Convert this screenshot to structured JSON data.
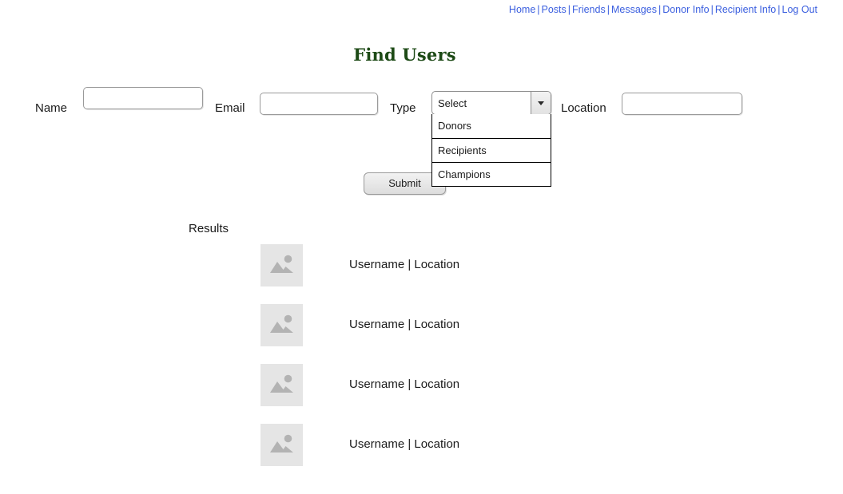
{
  "nav": {
    "separator": "|",
    "items": [
      {
        "label": "Home",
        "name": "nav-link-home"
      },
      {
        "label": "Posts",
        "name": "nav-link-posts"
      },
      {
        "label": "Friends",
        "name": "nav-link-friends"
      },
      {
        "label": "Messages",
        "name": "nav-link-messages"
      },
      {
        "label": "Donor Info",
        "name": "nav-link-donor-info"
      },
      {
        "label": "Recipient Info",
        "name": "nav-link-recipient-info"
      },
      {
        "label": "Log Out",
        "name": "nav-link-log-out"
      }
    ],
    "link_color": "#3b5fdf"
  },
  "page": {
    "title": "Find Users",
    "title_color": "#1d4a16",
    "background": "#ffffff"
  },
  "search_form": {
    "name": {
      "label": "Name",
      "value": "",
      "placeholder": ""
    },
    "email": {
      "label": "Email",
      "value": "",
      "placeholder": ""
    },
    "type": {
      "label": "Type",
      "selected": "Select",
      "expanded": true,
      "options": [
        {
          "label": "Donors"
        },
        {
          "label": "Recipients"
        },
        {
          "label": "Champions"
        }
      ],
      "caret_icon": "chevron-down-icon"
    },
    "location": {
      "label": "Location",
      "value": "",
      "placeholder": ""
    },
    "submit": {
      "label": "Submit"
    }
  },
  "results": {
    "label": "Results",
    "thumb_icon": "image-placeholder-icon",
    "thumb_bg": "#e5e5e5",
    "thumb_fg": "#b3b3b3",
    "items": [
      {
        "text": "Username | Location"
      },
      {
        "text": "Username | Location"
      },
      {
        "text": "Username | Location"
      },
      {
        "text": "Username | Location"
      }
    ]
  }
}
